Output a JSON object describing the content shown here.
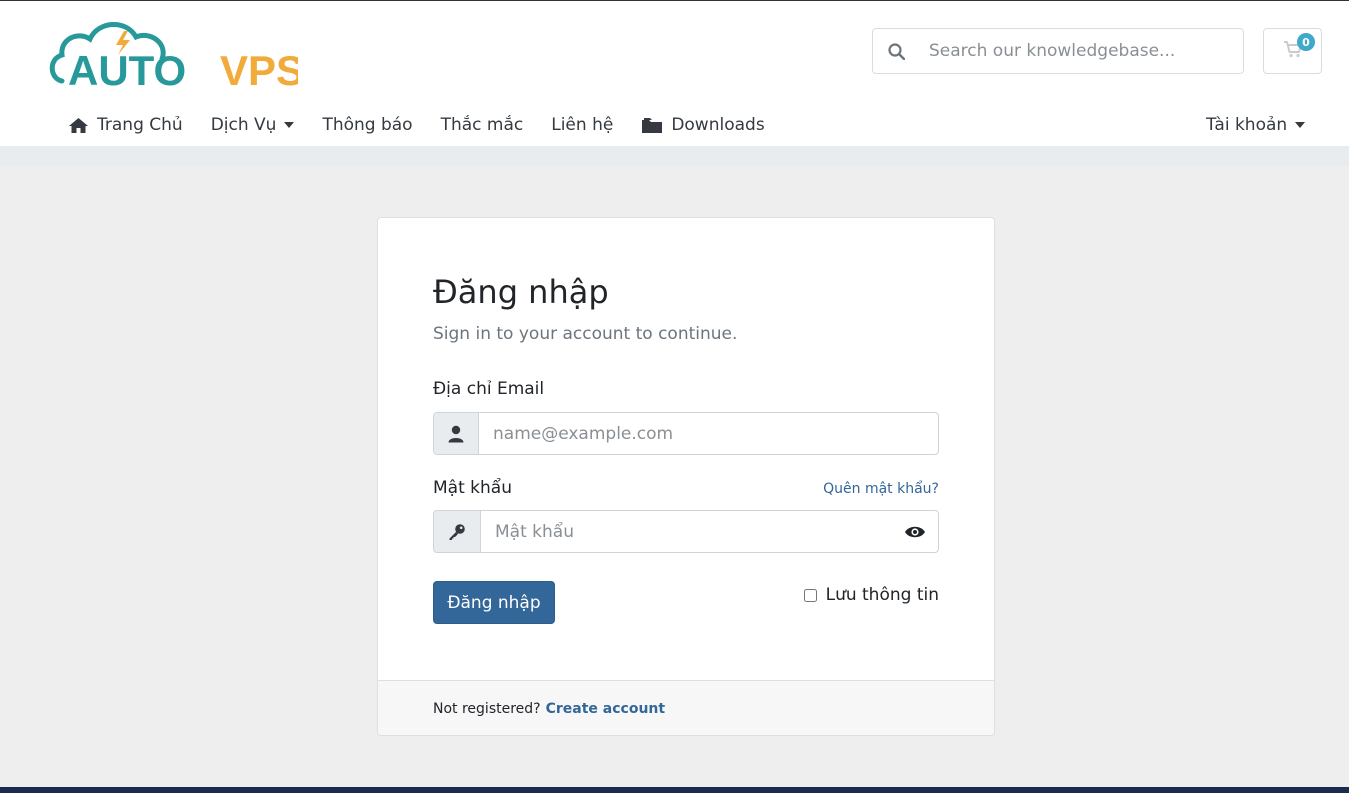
{
  "brand": {
    "logo_auto": "AUTO",
    "logo_vps": "VPS",
    "teal": "#27999b",
    "orange": "#f2ab3a"
  },
  "header": {
    "search_placeholder": "Search our knowledgebase...",
    "cart_count": "0"
  },
  "nav": {
    "items": [
      {
        "label": "Trang Chủ",
        "icon": "home-icon"
      },
      {
        "label": "Dịch Vụ",
        "dropdown": true
      },
      {
        "label": "Thông báo"
      },
      {
        "label": "Thắc mắc"
      },
      {
        "label": "Liên hệ"
      },
      {
        "label": "Downloads",
        "icon": "folder-icon"
      }
    ],
    "account_label": "Tài khoản"
  },
  "login": {
    "title": "Đăng nhập",
    "subtitle": "Sign in to your account to continue.",
    "email_label": "Địa chỉ Email",
    "email_placeholder": "name@example.com",
    "password_label": "Mật khẩu",
    "forgot_link": "Quên mật khẩu?",
    "password_placeholder": "Mật khẩu",
    "submit_label": "Đăng nhập",
    "remember_label": "Lưu thông tin",
    "footer_text": "Not registered?",
    "create_link": "Create account",
    "accent": "#336699"
  }
}
